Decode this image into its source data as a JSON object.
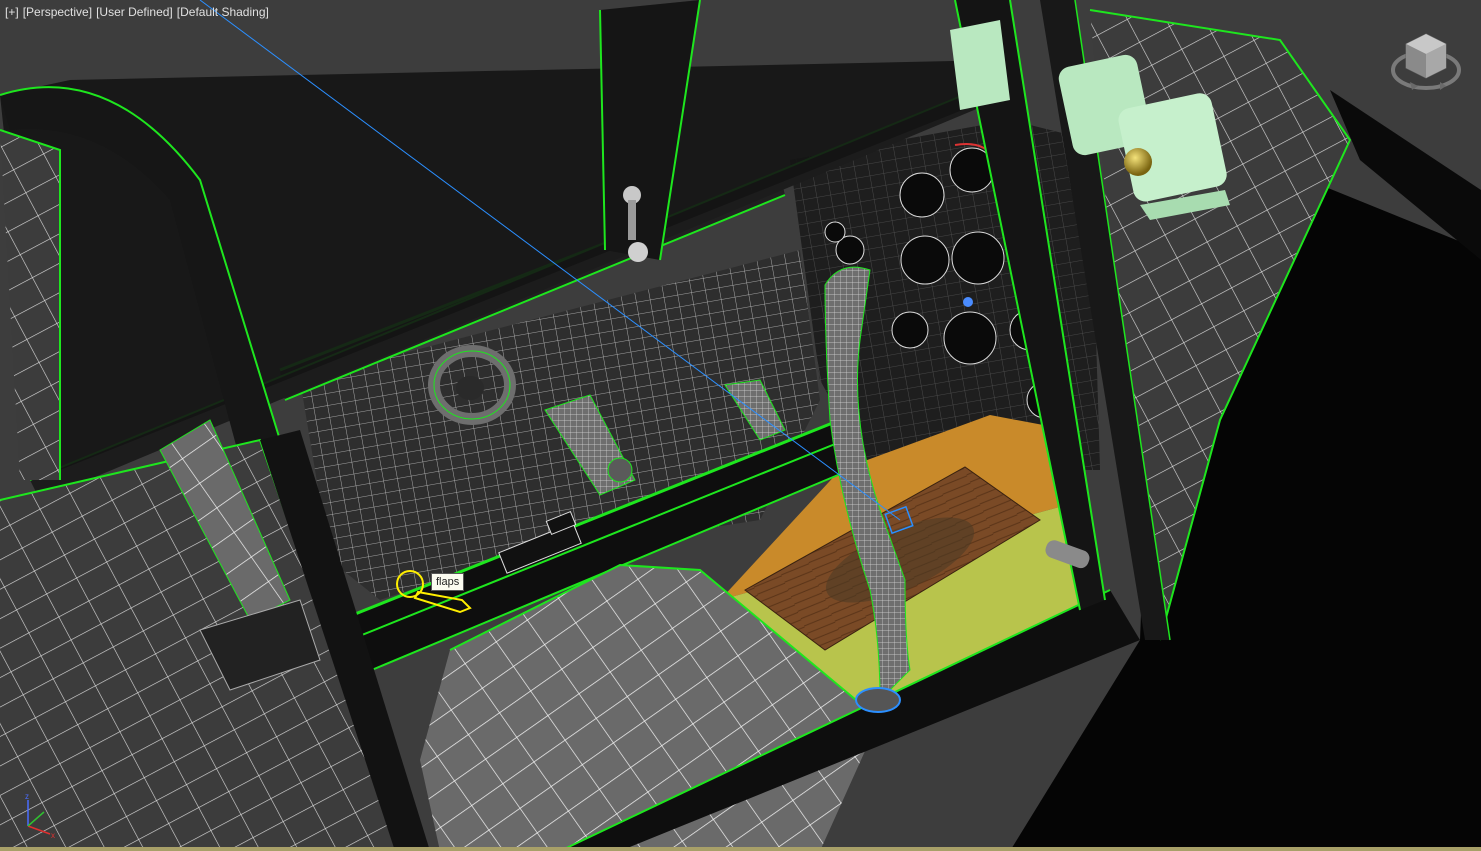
{
  "viewport": {
    "label_items": [
      "[+]",
      "[Perspective]",
      "[User Defined]",
      "[Default Shading]"
    ]
  },
  "tooltip": {
    "text": "flaps"
  },
  "colors": {
    "background": "#3d3d3d",
    "wire_green": "#1ee61e",
    "wire_white": "#e8e8e8",
    "selection_yellow": "#ffee00",
    "floor_orange": "#c98a2a",
    "floor_yellow": "#b8c44c",
    "wood": "#7a4a26",
    "gunsight": "#b9e8c0",
    "helper_blue": "#2b8fff"
  },
  "icons": [
    "viewcube-icon",
    "axis-tripod-icon"
  ]
}
